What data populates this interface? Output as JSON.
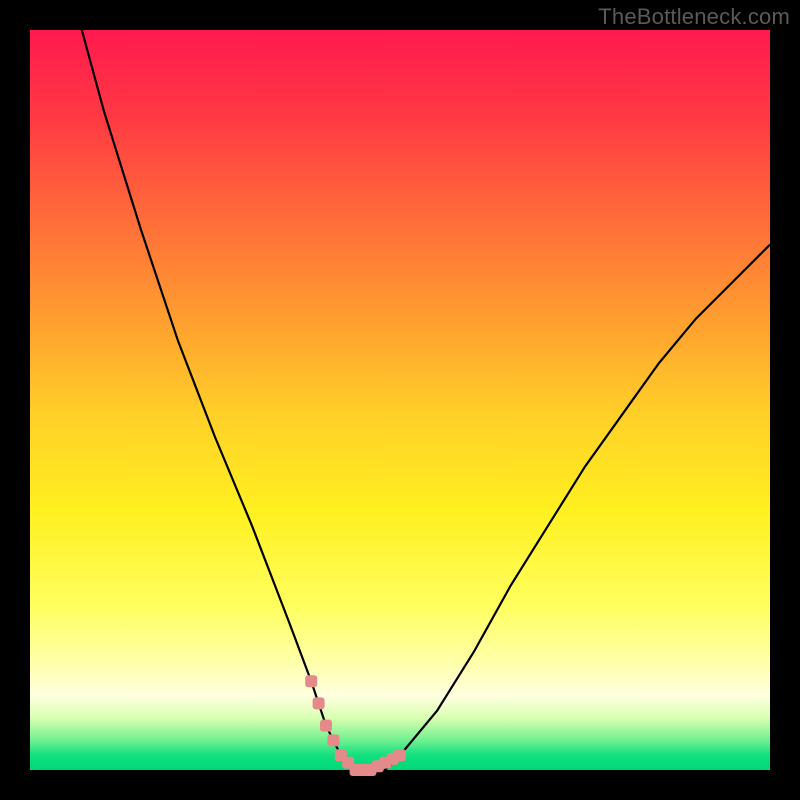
{
  "watermark": "TheBottleneck.com",
  "colors": {
    "frame": "#000000",
    "curve": "#000000",
    "marker": "#e58a8a",
    "gradient_top": "#ff1a4f",
    "gradient_bottom": "#00d878"
  },
  "chart_data": {
    "type": "line",
    "title": "",
    "xlabel": "",
    "ylabel": "",
    "xlim": [
      0,
      100
    ],
    "ylim": [
      0,
      100
    ],
    "series": [
      {
        "name": "bottleneck-curve",
        "x": [
          7,
          10,
          15,
          20,
          25,
          30,
          35,
          38,
          40,
          42,
          44,
          46,
          48,
          50,
          55,
          60,
          65,
          70,
          75,
          80,
          85,
          90,
          95,
          100
        ],
        "values": [
          100,
          89,
          73,
          58,
          45,
          33,
          20,
          12,
          6,
          2,
          0,
          0,
          0,
          2,
          8,
          16,
          25,
          33,
          41,
          48,
          55,
          61,
          66,
          71
        ]
      }
    ],
    "markers": {
      "name": "highlighted-range",
      "x": [
        38,
        39,
        40,
        41,
        42,
        43,
        44,
        45,
        46,
        47,
        48,
        49,
        50
      ],
      "values": [
        12,
        9,
        6,
        4,
        2,
        1,
        0,
        0,
        0,
        0.5,
        1,
        1.5,
        2
      ]
    }
  }
}
